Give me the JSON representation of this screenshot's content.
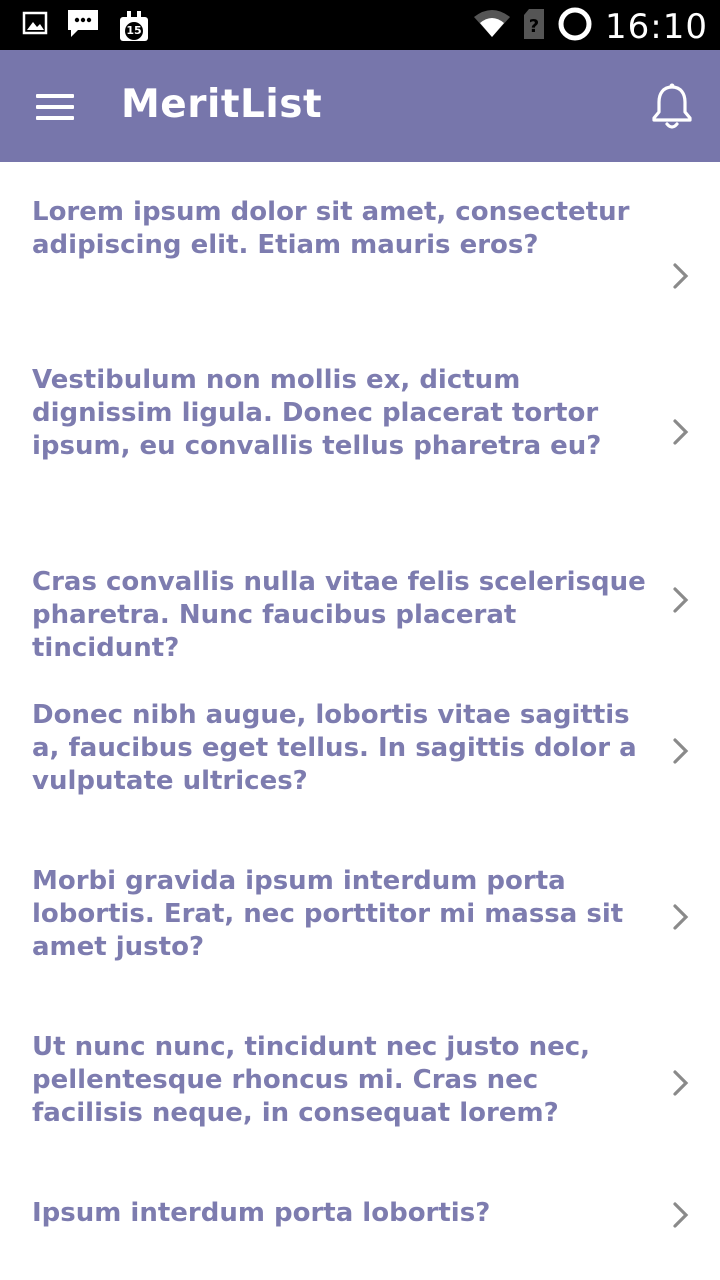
{
  "status_bar": {
    "time": "16:10",
    "icons": [
      "image-icon",
      "chat-icon",
      "calendar-icon",
      "wifi-icon",
      "no-sim-icon",
      "sync-icon"
    ],
    "calendar_day": "15"
  },
  "app_bar": {
    "title": "MeritList",
    "menu_icon": "menu-icon",
    "notification_icon": "bell-icon",
    "background": "#7776ab"
  },
  "questions": [
    {
      "text": "Lorem ipsum dolor sit amet, consectetur adipiscing elit. Etiam mauris eros?"
    },
    {
      "text": "Vestibulum non mollis ex, dictum dignissim ligula. Donec placerat tortor ipsum, eu convallis tellus pharetra eu?"
    },
    {
      "text": "Cras convallis nulla vitae felis scelerisque pharetra. Nunc faucibus placerat tincidunt?"
    },
    {
      "text": "Donec nibh augue, lobortis vitae sagittis a, faucibus eget tellus. In sagittis dolor a vulputate ultrices?"
    },
    {
      "text": "Morbi gravida ipsum interdum porta lobortis. Erat, nec porttitor mi massa sit amet justo?"
    },
    {
      "text": "Ut nunc nunc, tincidunt nec justo nec, pellentesque rhoncus mi. Cras nec facilisis neque, in consequat lorem?"
    },
    {
      "text": "Ipsum interdum porta lobortis?"
    }
  ],
  "colors": {
    "accent": "#7776ab",
    "chevron": "#8a8a8a"
  }
}
